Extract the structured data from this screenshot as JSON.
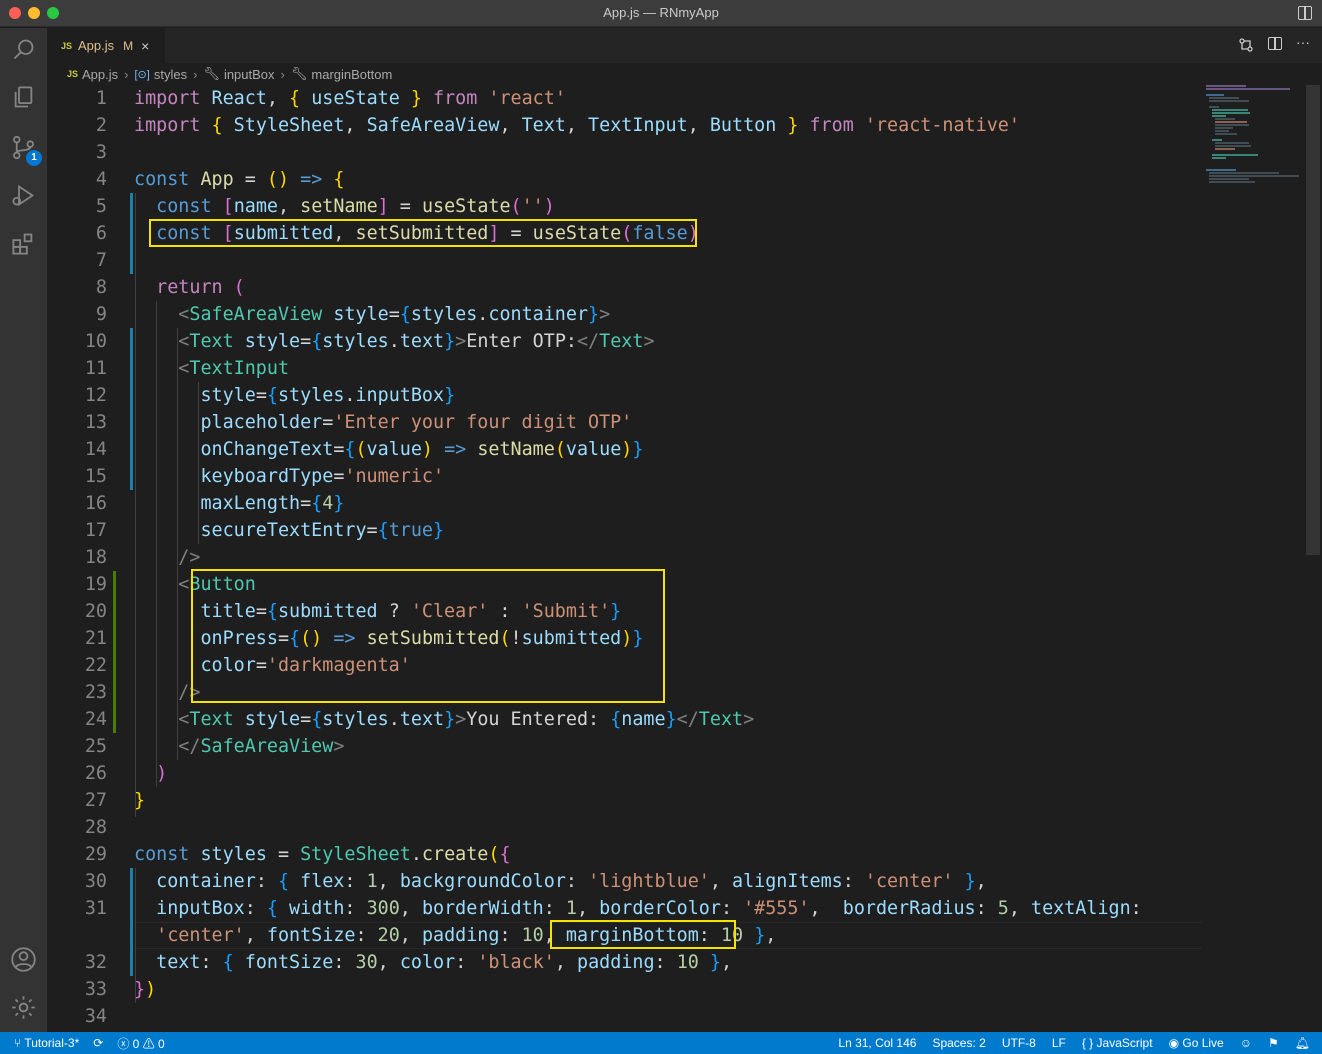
{
  "window": {
    "title": "App.js — RNmyApp"
  },
  "activity_bar": {
    "items": [
      "explorer-icon",
      "search-icon",
      "source-control-icon",
      "run-debug-icon",
      "extensions-icon"
    ],
    "scm_badge": "1",
    "bottom_items": [
      "account-icon",
      "manage-gear-icon"
    ]
  },
  "tab": {
    "js_badge": "JS",
    "name": "App.js",
    "modified": "M",
    "close": "×"
  },
  "tab_actions": {
    "more": "···"
  },
  "breadcrumb": {
    "file_badge": "JS",
    "file": "App.js",
    "styles": "styles",
    "inputBox": "inputBox",
    "marginBottom": "marginBottom"
  },
  "editor": {
    "line_numbers": [
      "1",
      "2",
      "3",
      "4",
      "5",
      "6",
      "7",
      "8",
      "9",
      "10",
      "11",
      "12",
      "13",
      "14",
      "15",
      "16",
      "17",
      "18",
      "19",
      "20",
      "21",
      "22",
      "23",
      "24",
      "25",
      "26",
      "27",
      "28",
      "29",
      "30",
      "31",
      "",
      "32",
      "33",
      "34"
    ],
    "plain_lines": [
      "import React, { useState } from 'react'",
      "import { StyleSheet, SafeAreaView, Text, TextInput, Button } from 'react-native'"
    ]
  },
  "status_bar": {
    "branch": "Tutorial-3*",
    "errors": "0",
    "warnings": "0",
    "cursor": "Ln 31, Col 146",
    "spaces": "Spaces: 2",
    "encoding": "UTF-8",
    "eol": "LF",
    "language": "{ } JavaScript",
    "golive": "Go Live"
  },
  "colors": {
    "accent": "#007acc",
    "highlight_box": "#f5e200",
    "editor_bg": "#1e1e1e"
  }
}
